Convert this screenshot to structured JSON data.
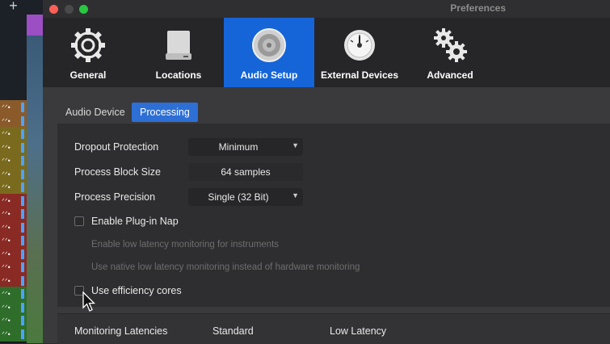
{
  "background_app": {
    "add_button": "+",
    "tracks": [
      {
        "label": "ᐟᐟ•",
        "color": "#8a5a2b"
      },
      {
        "label": "ᐟᐟ•",
        "color": "#8a5a2b"
      },
      {
        "label": "ᐟᐟ•",
        "color": "#7a6a1e"
      },
      {
        "label": "ᐟᐟ•",
        "color": "#7a6a1e"
      },
      {
        "label": "ᐟᐟ•",
        "color": "#7a6a1e"
      },
      {
        "label": "ᐟᐟ•",
        "color": "#7a6a1e"
      },
      {
        "label": "ᐟᐟ•",
        "color": "#7a6a1e"
      },
      {
        "label": "ᐟᐟ•",
        "color": "#8a2a24"
      },
      {
        "label": "ᐟᐟ•",
        "color": "#8a2a24"
      },
      {
        "label": "ᐟᐟ•",
        "color": "#8a2a24"
      },
      {
        "label": "ᐟᐟ•",
        "color": "#8a2a24"
      },
      {
        "label": "ᐟᐟ•",
        "color": "#8a2a24"
      },
      {
        "label": "ᐟᐟ•",
        "color": "#8a2a24"
      },
      {
        "label": "ᐟᐟ•",
        "color": "#8a2a24"
      },
      {
        "label": "ᐟᐟ•",
        "color": "#2e6e2a"
      },
      {
        "label": "ᐟᐟ•",
        "color": "#2e6e2a"
      },
      {
        "label": "ᐟᐟ•",
        "color": "#2e6e2a"
      },
      {
        "label": "ᐟᐟ•",
        "color": "#2e6e2a"
      }
    ]
  },
  "window": {
    "title": "Preferences"
  },
  "toolbar": {
    "items": [
      {
        "label": "General",
        "icon": "gear-icon",
        "selected": false
      },
      {
        "label": "Locations",
        "icon": "drive-icon",
        "selected": false
      },
      {
        "label": "Audio Setup",
        "icon": "speaker-icon",
        "selected": true
      },
      {
        "label": "External Devices",
        "icon": "dial-icon",
        "selected": false
      },
      {
        "label": "Advanced",
        "icon": "gears-icon",
        "selected": false
      }
    ]
  },
  "subtabs": {
    "audio_device": "Audio Device",
    "processing": "Processing",
    "active": "processing"
  },
  "processing": {
    "dropout_protection": {
      "label": "Dropout Protection",
      "value": "Minimum"
    },
    "process_block_size": {
      "label": "Process Block Size",
      "value": "64 samples"
    },
    "process_precision": {
      "label": "Process Precision",
      "value": "Single (32 Bit)"
    },
    "enable_plugin_nap": {
      "label": "Enable Plug-in Nap",
      "checked": false
    },
    "low_latency_instruments": {
      "label": "Enable low latency monitoring for instruments",
      "enabled": false
    },
    "native_low_latency": {
      "label": "Use native low latency monitoring instead of hardware monitoring",
      "enabled": false
    },
    "efficiency_cores": {
      "label": "Use efficiency cores",
      "checked": false
    }
  },
  "latencies": {
    "label": "Monitoring Latencies",
    "col_standard": "Standard",
    "col_low": "Low Latency"
  },
  "colors": {
    "accent": "#1565d8",
    "subtab_active": "#2d6fd4"
  }
}
